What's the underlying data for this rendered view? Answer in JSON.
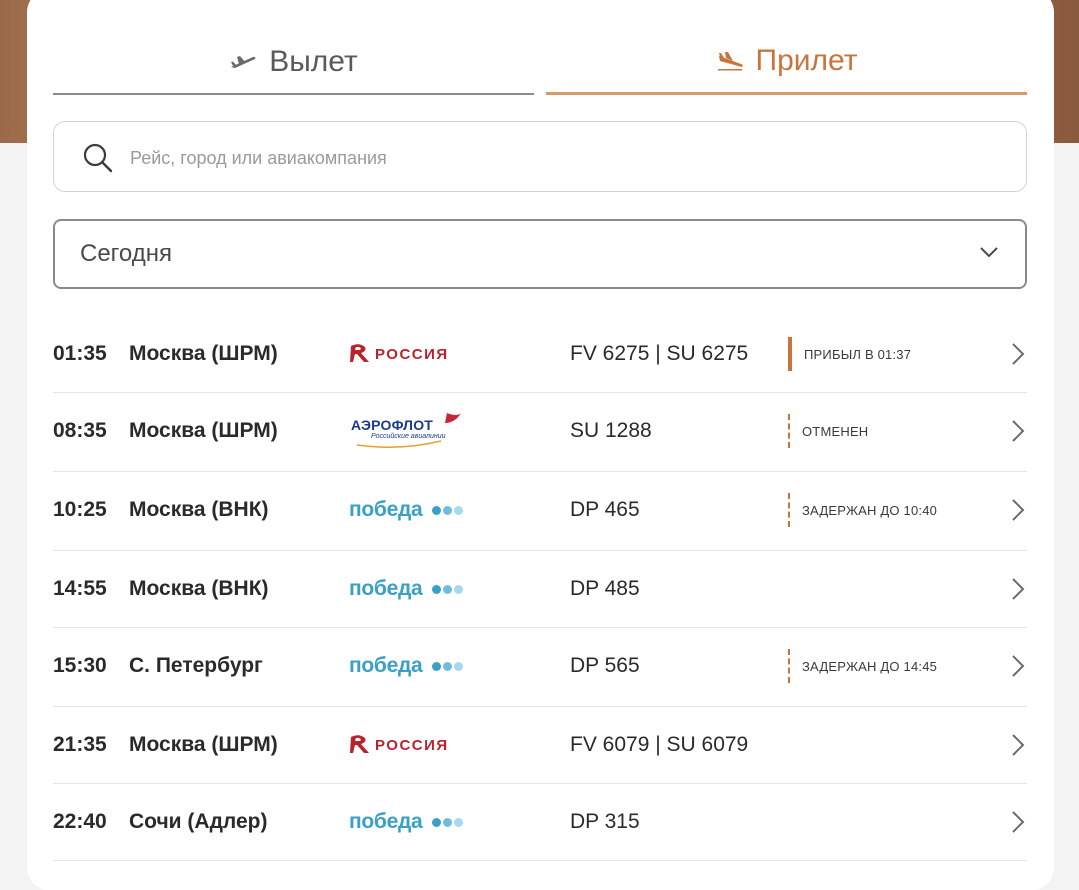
{
  "tabs": {
    "departure": {
      "label": "Вылет",
      "icon": "plane-takeoff-icon"
    },
    "arrival": {
      "label": "Прилет",
      "icon": "plane-landing-icon",
      "active": true
    }
  },
  "search": {
    "placeholder": "Рейс, город или авиакомпания",
    "value": ""
  },
  "date_select": {
    "value": "Сегодня"
  },
  "colors": {
    "accent": "#c8743c",
    "pobeda": "#3aa0c8",
    "rossiya": "#b8242e",
    "aeroflot_blue": "#1a3a8a"
  },
  "flights": [
    {
      "time": "01:35",
      "city": "Москва (ШРМ)",
      "airline": "rossiya",
      "flight": "FV 6275 | SU 6275",
      "status": "ПРИБЫЛ В 01:37",
      "status_style": "solid"
    },
    {
      "time": "08:35",
      "city": "Москва (ШРМ)",
      "airline": "aeroflot",
      "flight": "SU 1288",
      "status": "ОТМЕНЕН",
      "status_style": "dashed"
    },
    {
      "time": "10:25",
      "city": "Москва (ВНК)",
      "airline": "pobeda",
      "flight": "DP 465",
      "status": "ЗАДЕРЖАН ДО 10:40",
      "status_style": "dashed"
    },
    {
      "time": "14:55",
      "city": "Москва (ВНК)",
      "airline": "pobeda",
      "flight": "DP 485",
      "status": "",
      "status_style": ""
    },
    {
      "time": "15:30",
      "city": "С. Петербург",
      "airline": "pobeda",
      "flight": "DP 565",
      "status": "ЗАДЕРЖАН ДО 14:45",
      "status_style": "dashed"
    },
    {
      "time": "21:35",
      "city": "Москва (ШРМ)",
      "airline": "rossiya",
      "flight": "FV 6079 | SU 6079",
      "status": "",
      "status_style": ""
    },
    {
      "time": "22:40",
      "city": "Сочи (Адлер)",
      "airline": "pobeda",
      "flight": "DP 315",
      "status": "",
      "status_style": ""
    }
  ],
  "airline_logos": {
    "rossiya": {
      "text": "РОССИЯ"
    },
    "aeroflot": {
      "text": "АЭРОФЛОТ",
      "subtext": "Российские авиалинии"
    },
    "pobeda": {
      "text": "победа"
    }
  }
}
